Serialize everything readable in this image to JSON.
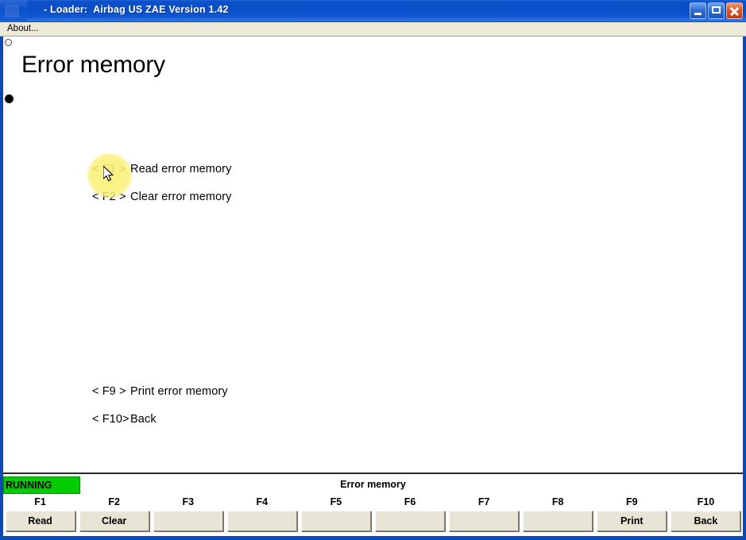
{
  "window": {
    "title": "- Loader:  Airbag US ZAE Version 1.42",
    "icon": "app-icon",
    "controls": {
      "minimize": "minimize-icon",
      "maximize": "maximize-icon",
      "close": "close-icon"
    }
  },
  "menubar": {
    "items": [
      {
        "label": "About..."
      }
    ]
  },
  "main": {
    "heading": "Error memory",
    "items": [
      {
        "key": "< F1 >",
        "label": "Read error memory"
      },
      {
        "key": "< F2 >",
        "label": "Clear error memory"
      },
      {
        "key": "< F9 >",
        "label": "Print error memory"
      },
      {
        "key": "< F10>",
        "label": "Back"
      }
    ]
  },
  "statusbar": {
    "state": "RUNNING",
    "state_color": "#00cc00",
    "screen_name": "Error memory",
    "function_keys": [
      {
        "key": "F1",
        "label": "Read",
        "enabled": true
      },
      {
        "key": "F2",
        "label": "Clear",
        "enabled": true
      },
      {
        "key": "F3",
        "label": "",
        "enabled": false
      },
      {
        "key": "F4",
        "label": "",
        "enabled": false
      },
      {
        "key": "F5",
        "label": "",
        "enabled": false
      },
      {
        "key": "F6",
        "label": "",
        "enabled": false
      },
      {
        "key": "F7",
        "label": "",
        "enabled": false
      },
      {
        "key": "F8",
        "label": "",
        "enabled": false
      },
      {
        "key": "F9",
        "label": "Print",
        "enabled": true
      },
      {
        "key": "F10",
        "label": "Back",
        "enabled": true
      }
    ]
  },
  "colors": {
    "titlebar_blue": "#0d4fc8",
    "frame_blue": "#0b49b8",
    "menubar_bg": "#ece9d8",
    "button_face": "#e8e4d6",
    "running_green": "#00cc00",
    "cursor_highlight": "#faf078"
  }
}
